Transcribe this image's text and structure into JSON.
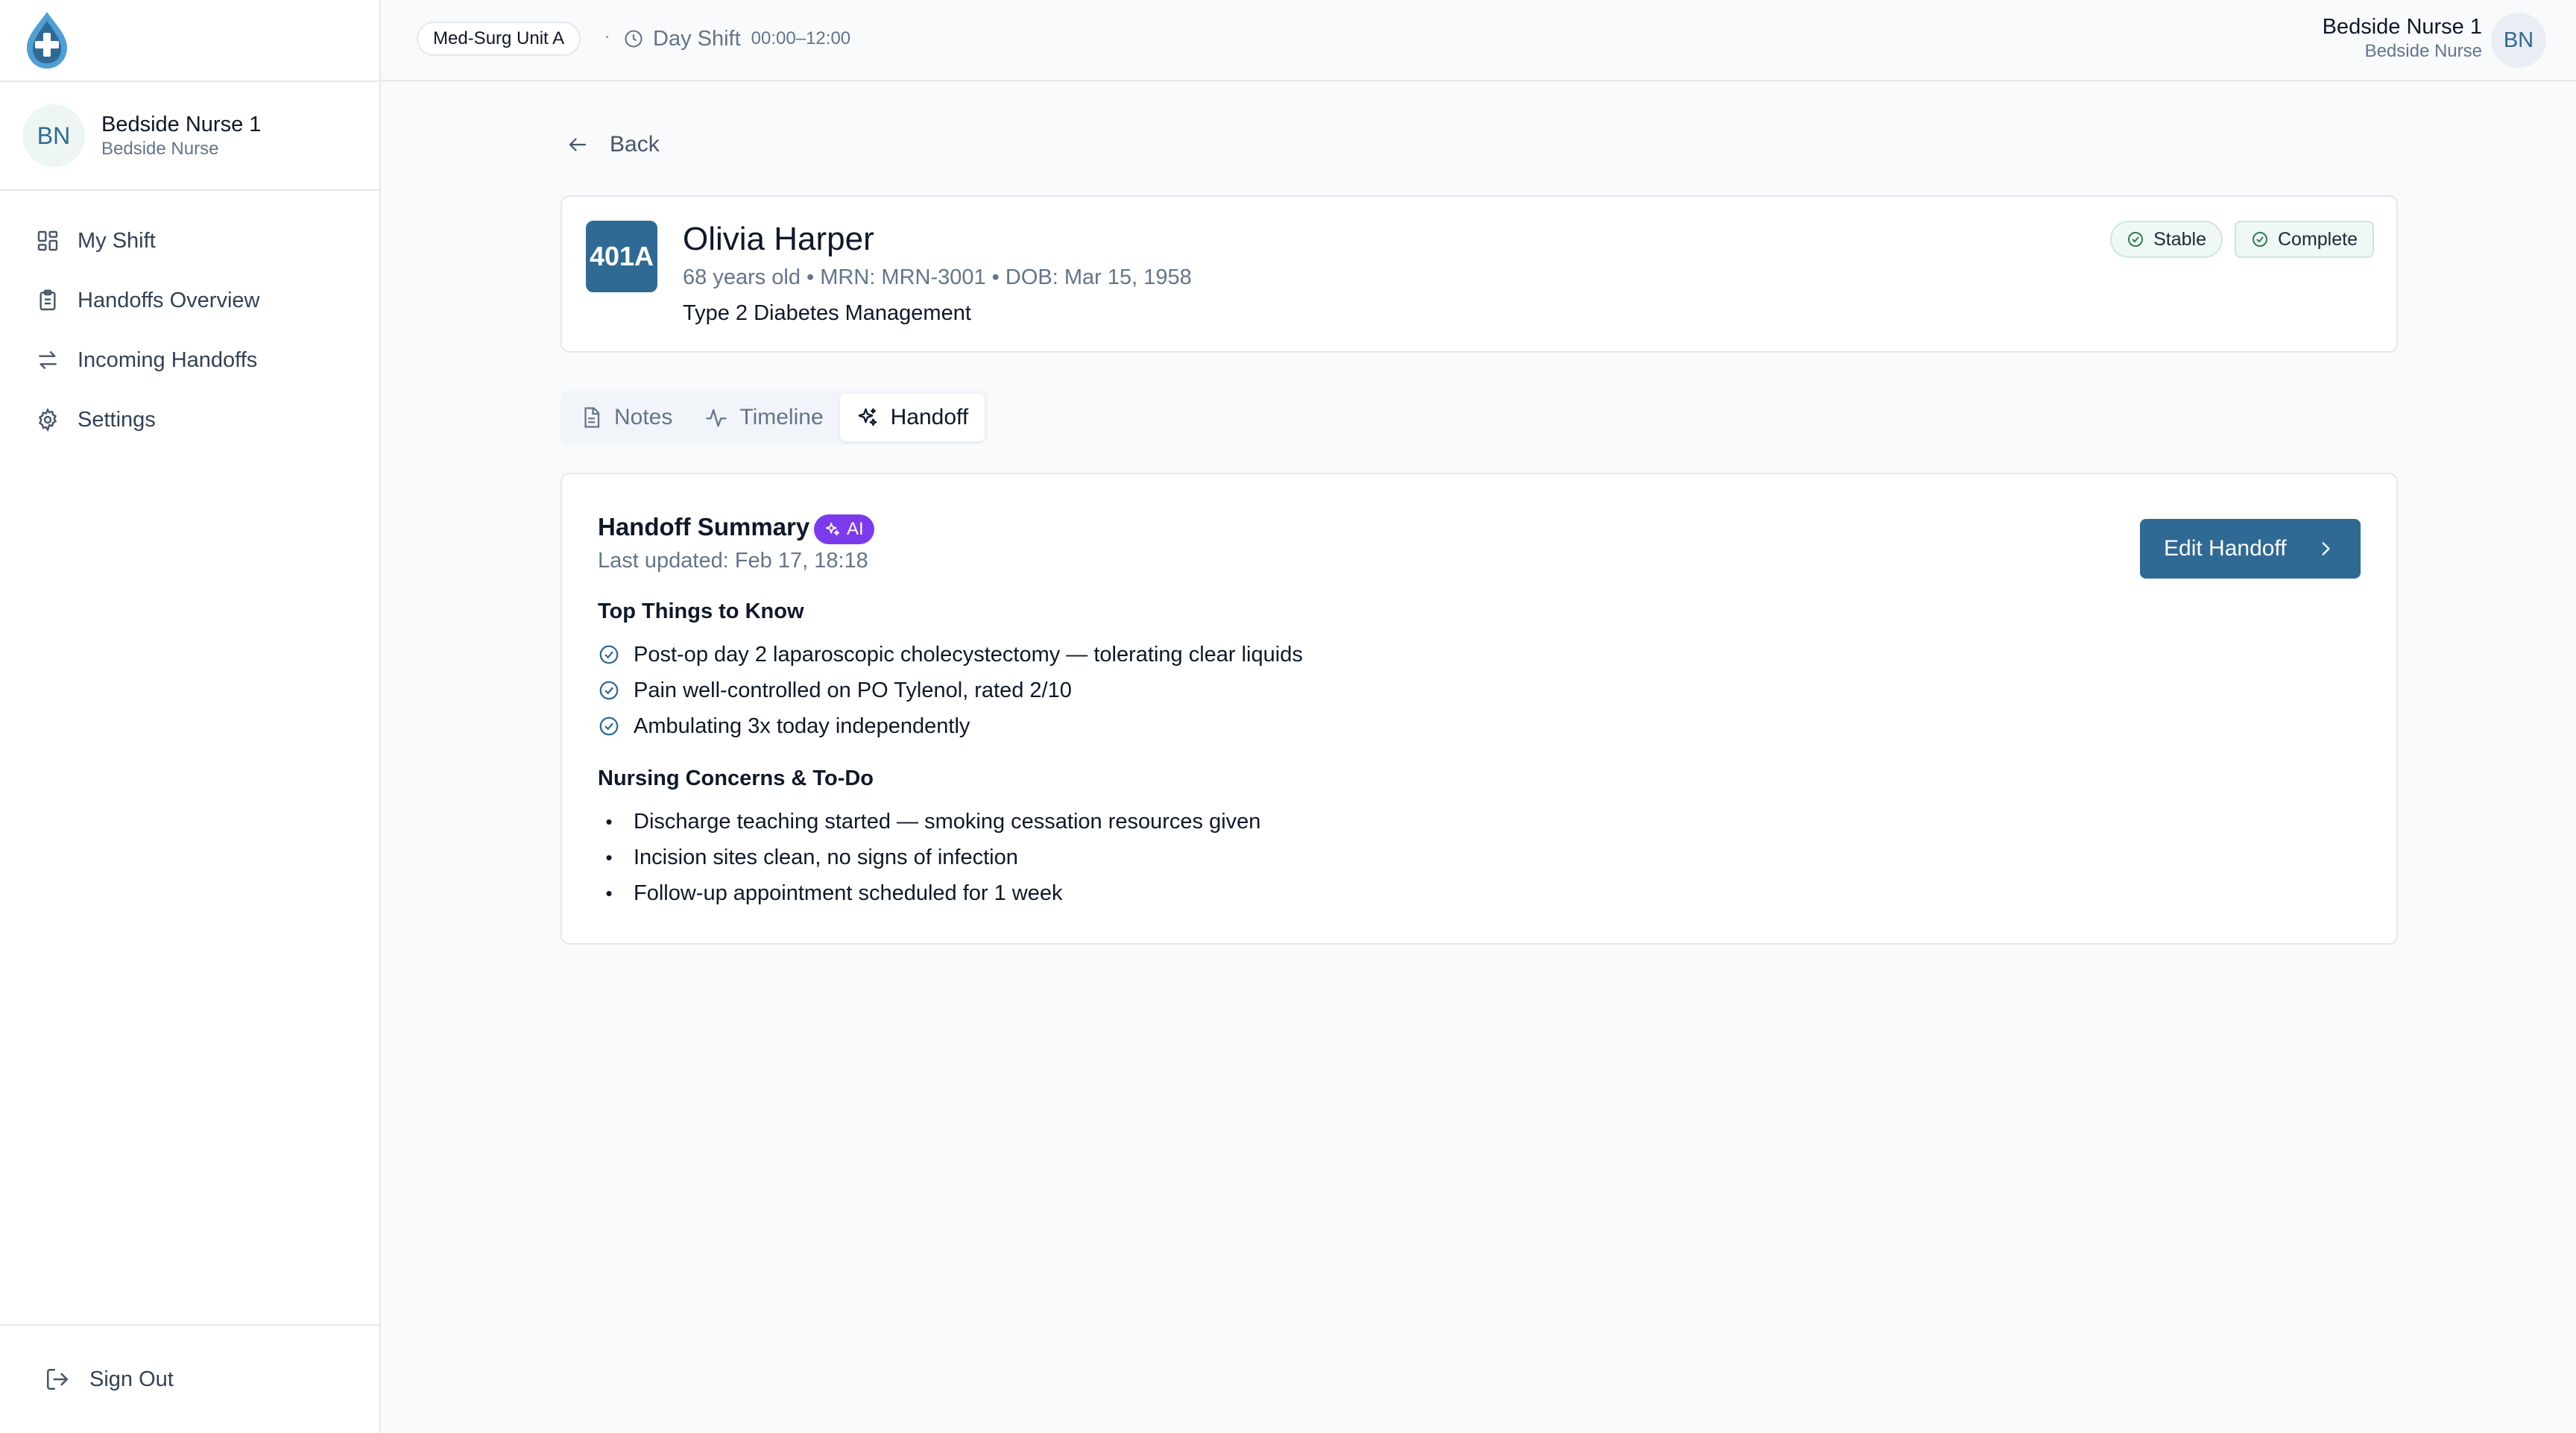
{
  "app": {
    "logo_icon": "water-drop-cross-logo"
  },
  "sidebar": {
    "user": {
      "initials": "BN",
      "name": "Bedside Nurse 1",
      "role": "Bedside Nurse"
    },
    "nav": [
      {
        "label": "My Shift",
        "icon": "grid-icon"
      },
      {
        "label": "Handoffs Overview",
        "icon": "clipboard-icon"
      },
      {
        "label": "Incoming Handoffs",
        "icon": "swap-arrows-icon"
      },
      {
        "label": "Settings",
        "icon": "gear-icon"
      }
    ],
    "signout": "Sign Out"
  },
  "topbar": {
    "unit": "Med-Surg Unit A",
    "separator": "·",
    "shift_name": "Day Shift",
    "shift_time": "00:00–12:00",
    "user_name": "Bedside Nurse 1",
    "user_role": "Bedside Nurse",
    "user_initials": "BN"
  },
  "back_label": "Back",
  "patient": {
    "room": "401A",
    "name": "Olivia Harper",
    "meta": "68 years old • MRN: MRN-3001 • DOB: Mar 15, 1958",
    "diagnosis": "Type 2 Diabetes Management",
    "status_condition": "Stable",
    "status_handoff": "Complete"
  },
  "tabs": [
    {
      "label": "Notes",
      "icon": "document-icon"
    },
    {
      "label": "Timeline",
      "icon": "activity-icon"
    },
    {
      "label": "Handoff",
      "icon": "sparkles-icon",
      "active": true
    }
  ],
  "summary": {
    "title": "Handoff Summary",
    "ai_badge": "AI",
    "last_updated": "Last updated: Feb 17, 18:18",
    "edit_button": "Edit Handoff",
    "top_heading": "Top Things to Know",
    "top_items": [
      "Post-op day 2 laparoscopic cholecystectomy — tolerating clear liquids",
      "Pain well-controlled on PO Tylenol, rated 2/10",
      "Ambulating 3x today independently"
    ],
    "concerns_heading": "Nursing Concerns & To-Do",
    "concern_items": [
      "Discharge teaching started — smoking cessation resources given",
      "Incision sites clean, no signs of infection",
      "Follow-up appointment scheduled for 1 week"
    ]
  },
  "colors": {
    "primary": "#2f6a95",
    "ai": "#7c3aed",
    "success": "#2f7a56"
  }
}
